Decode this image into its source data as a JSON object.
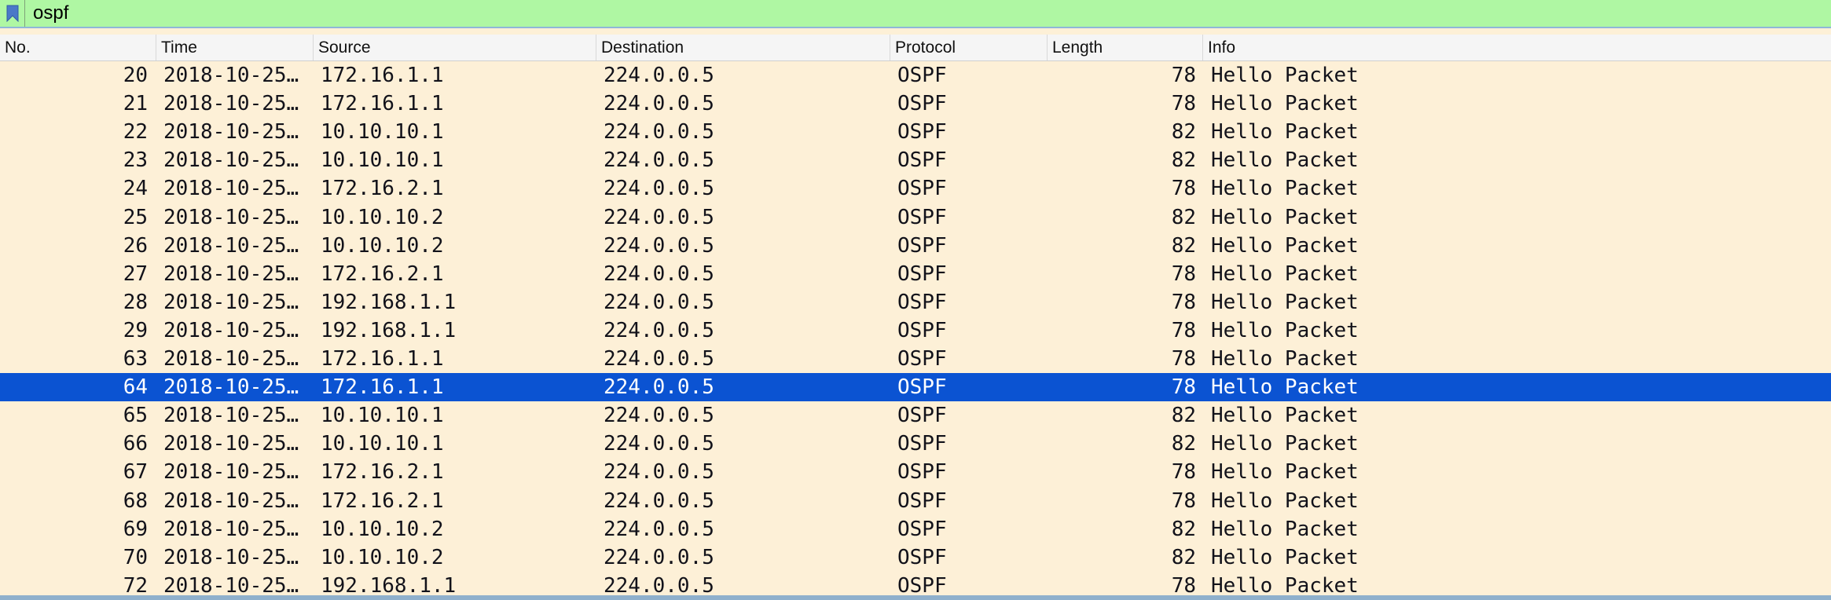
{
  "filter": {
    "value": "ospf"
  },
  "columns": [
    "No.",
    "Time",
    "Source",
    "Destination",
    "Protocol",
    "Length",
    "Info"
  ],
  "rows": [
    {
      "no": "20",
      "time": "2018-10-25…",
      "source": "172.16.1.1",
      "destination": "224.0.0.5",
      "protocol": "OSPF",
      "length": "78",
      "info": "Hello Packet"
    },
    {
      "no": "21",
      "time": "2018-10-25…",
      "source": "172.16.1.1",
      "destination": "224.0.0.5",
      "protocol": "OSPF",
      "length": "78",
      "info": "Hello Packet"
    },
    {
      "no": "22",
      "time": "2018-10-25…",
      "source": "10.10.10.1",
      "destination": "224.0.0.5",
      "protocol": "OSPF",
      "length": "82",
      "info": "Hello Packet"
    },
    {
      "no": "23",
      "time": "2018-10-25…",
      "source": "10.10.10.1",
      "destination": "224.0.0.5",
      "protocol": "OSPF",
      "length": "82",
      "info": "Hello Packet"
    },
    {
      "no": "24",
      "time": "2018-10-25…",
      "source": "172.16.2.1",
      "destination": "224.0.0.5",
      "protocol": "OSPF",
      "length": "78",
      "info": "Hello Packet"
    },
    {
      "no": "25",
      "time": "2018-10-25…",
      "source": "10.10.10.2",
      "destination": "224.0.0.5",
      "protocol": "OSPF",
      "length": "82",
      "info": "Hello Packet"
    },
    {
      "no": "26",
      "time": "2018-10-25…",
      "source": "10.10.10.2",
      "destination": "224.0.0.5",
      "protocol": "OSPF",
      "length": "82",
      "info": "Hello Packet"
    },
    {
      "no": "27",
      "time": "2018-10-25…",
      "source": "172.16.2.1",
      "destination": "224.0.0.5",
      "protocol": "OSPF",
      "length": "78",
      "info": "Hello Packet"
    },
    {
      "no": "28",
      "time": "2018-10-25…",
      "source": "192.168.1.1",
      "destination": "224.0.0.5",
      "protocol": "OSPF",
      "length": "78",
      "info": "Hello Packet"
    },
    {
      "no": "29",
      "time": "2018-10-25…",
      "source": "192.168.1.1",
      "destination": "224.0.0.5",
      "protocol": "OSPF",
      "length": "78",
      "info": "Hello Packet"
    },
    {
      "no": "63",
      "time": "2018-10-25…",
      "source": "172.16.1.1",
      "destination": "224.0.0.5",
      "protocol": "OSPF",
      "length": "78",
      "info": "Hello Packet"
    },
    {
      "no": "64",
      "time": "2018-10-25…",
      "source": "172.16.1.1",
      "destination": "224.0.0.5",
      "protocol": "OSPF",
      "length": "78",
      "info": "Hello Packet",
      "selected": true
    },
    {
      "no": "65",
      "time": "2018-10-25…",
      "source": "10.10.10.1",
      "destination": "224.0.0.5",
      "protocol": "OSPF",
      "length": "82",
      "info": "Hello Packet"
    },
    {
      "no": "66",
      "time": "2018-10-25…",
      "source": "10.10.10.1",
      "destination": "224.0.0.5",
      "protocol": "OSPF",
      "length": "82",
      "info": "Hello Packet"
    },
    {
      "no": "67",
      "time": "2018-10-25…",
      "source": "172.16.2.1",
      "destination": "224.0.0.5",
      "protocol": "OSPF",
      "length": "78",
      "info": "Hello Packet"
    },
    {
      "no": "68",
      "time": "2018-10-25…",
      "source": "172.16.2.1",
      "destination": "224.0.0.5",
      "protocol": "OSPF",
      "length": "78",
      "info": "Hello Packet"
    },
    {
      "no": "69",
      "time": "2018-10-25…",
      "source": "10.10.10.2",
      "destination": "224.0.0.5",
      "protocol": "OSPF",
      "length": "82",
      "info": "Hello Packet"
    },
    {
      "no": "70",
      "time": "2018-10-25…",
      "source": "10.10.10.2",
      "destination": "224.0.0.5",
      "protocol": "OSPF",
      "length": "82",
      "info": "Hello Packet"
    },
    {
      "no": "72",
      "time": "2018-10-25…",
      "source": "192.168.1.1",
      "destination": "224.0.0.5",
      "protocol": "OSPF",
      "length": "78",
      "info": "Hello Packet"
    }
  ],
  "colors": {
    "filter_valid_bg": "#aff7a3",
    "row_bg": "#fdf0d7",
    "selected_bg": "#0b53d2",
    "selected_text": "#ffffff"
  },
  "icons": {
    "filter_bookmark": "bookmark-icon"
  }
}
